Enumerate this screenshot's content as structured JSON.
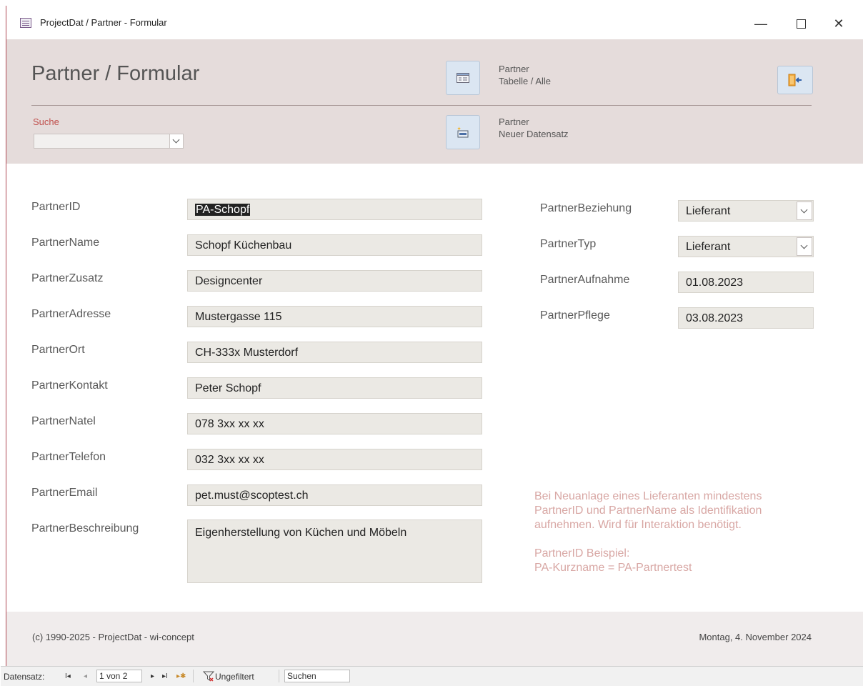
{
  "window": {
    "title": "ProjectDat / Partner - Formular",
    "min_glyph": "—",
    "close_glyph": "✕"
  },
  "header": {
    "title": "Partner / Formular",
    "search_label": "Suche",
    "search_value": "",
    "btn_table": {
      "line1": "Partner",
      "line2": "Tabelle / Alle"
    },
    "btn_new": {
      "line1": "Partner",
      "line2": "Neuer Datensatz"
    }
  },
  "fields_left": [
    {
      "label": "PartnerID",
      "value": "PA-Schopf"
    },
    {
      "label": "PartnerName",
      "value": "Schopf Küchenbau"
    },
    {
      "label": "PartnerZusatz",
      "value": "Designcenter"
    },
    {
      "label": "PartnerAdresse",
      "value": "Mustergasse 115"
    },
    {
      "label": "PartnerOrt",
      "value": "CH-333x Musterdorf"
    },
    {
      "label": "PartnerKontakt",
      "value": "Peter Schopf"
    },
    {
      "label": "PartnerNatel",
      "value": "078 3xx xx xx"
    },
    {
      "label": "PartnerTelefon",
      "value": "032 3xx xx xx"
    },
    {
      "label": "PartnerEmail",
      "value": "pet.must@scoptest.ch"
    },
    {
      "label": "PartnerBeschreibung",
      "value": "Eigenherstellung von Küchen und Möbeln"
    }
  ],
  "fields_right": [
    {
      "label": "PartnerBeziehung",
      "value": "Lieferant"
    },
    {
      "label": "PartnerTyp",
      "value": "Lieferant"
    },
    {
      "label": "PartnerAufnahme",
      "value": "01.08.2023"
    },
    {
      "label": "PartnerPflege",
      "value": "03.08.2023"
    }
  ],
  "info": {
    "line1": "Bei Neuanlage eines Lieferanten mindestens",
    "line2": "PartnerID und PartnerName als Identifikation",
    "line3": "aufnehmen. Wird für Interaktion benötigt.",
    "line4": "PartnerID Beispiel:",
    "line5": "PA-Kurzname = PA-Partnertest"
  },
  "footer": {
    "copyright": "(c) 1990-2025 - ProjectDat - wi-concept",
    "date": "Montag, 4. November 2024"
  },
  "navbar": {
    "record_label": "Datensatz:",
    "first_glyph": "I◂",
    "prev_glyph": "◂",
    "position": "1 von 2",
    "next_glyph": "▸",
    "last_glyph": "▸I",
    "new_glyph": "▸✱",
    "filter": "Ungefiltert",
    "search": "Suchen"
  }
}
